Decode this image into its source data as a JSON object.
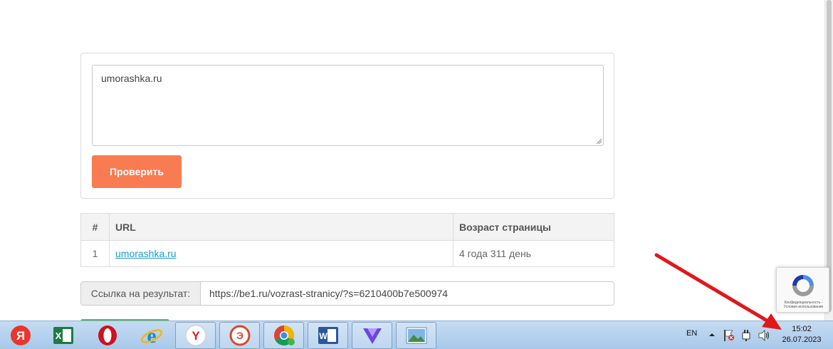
{
  "checker": {
    "input_value": "umorashka.ru",
    "check_label": "Проверить"
  },
  "results": {
    "headers": [
      "#",
      "URL",
      "Возраст страницы"
    ],
    "rows": [
      {
        "num": "1",
        "url": "umorashka.ru",
        "age": "4 года 311 день"
      }
    ]
  },
  "result_link": {
    "label": "Ссылка на результат:",
    "value": "https://be1.ru/vozrast-stranicy/?s=6210400b7e500974"
  },
  "recaptcha": {
    "text": "Конфиденциальность - Условия использования"
  },
  "taskbar": {
    "apps": [
      {
        "icon": "yandex-icon",
        "glyph": "Я",
        "color": "#e8372e"
      },
      {
        "icon": "excel-icon",
        "glyph": "X",
        "color": "#1f7a44"
      },
      {
        "icon": "opera-icon",
        "glyph": "O",
        "color": "#d0101e"
      },
      {
        "icon": "internet-explorer-icon",
        "glyph": "e",
        "color": "#1e88d8"
      },
      {
        "icon": "yandex-browser-icon",
        "glyph": "Y",
        "color": "#d81e1e"
      },
      {
        "icon": "app-icon",
        "glyph": "Э",
        "color": "#d84a2e"
      },
      {
        "icon": "chrome-icon",
        "glyph": "",
        "color": "#4285f4"
      },
      {
        "icon": "word-icon",
        "glyph": "W",
        "color": "#2b579a"
      },
      {
        "icon": "vpn-icon",
        "glyph": "",
        "color": "#6e45e2"
      },
      {
        "icon": "photo-viewer-icon",
        "glyph": "",
        "color": "#3c8ac8"
      }
    ],
    "language": "EN",
    "time": "15:02",
    "date": "26.07.2023"
  }
}
